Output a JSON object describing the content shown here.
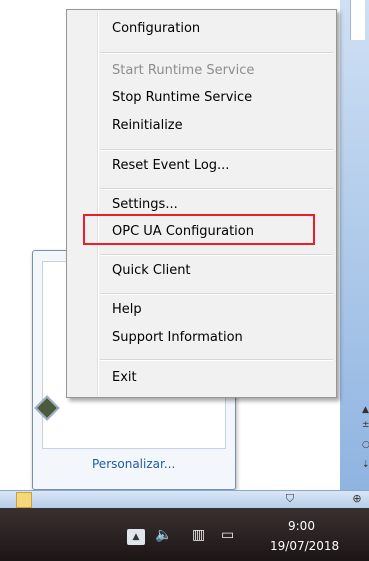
{
  "context_menu": {
    "items": [
      {
        "label": "Configuration",
        "enabled": true
      },
      {
        "label": "Start Runtime Service",
        "enabled": false
      },
      {
        "label": "Stop Runtime Service",
        "enabled": true
      },
      {
        "label": "Reinitialize",
        "enabled": true
      },
      {
        "label": "Reset Event Log...",
        "enabled": true
      },
      {
        "label": "Settings...",
        "enabled": true
      },
      {
        "label": "OPC UA Configuration",
        "enabled": true,
        "highlighted": true
      },
      {
        "label": "Quick Client",
        "enabled": true
      },
      {
        "label": "Help",
        "enabled": true
      },
      {
        "label": "Support Information",
        "enabled": true
      },
      {
        "label": "Exit",
        "enabled": true
      }
    ],
    "highlight_color": "#e8202a"
  },
  "tray_flyout": {
    "personalize_link": "Personalizar..."
  },
  "clock": {
    "time": "9:00",
    "date": "19/07/2018"
  },
  "icons": {
    "tray_up": "chevron-up-icon",
    "volume": "speaker-icon",
    "network": "network-icon",
    "action_center": "flag-icon"
  }
}
